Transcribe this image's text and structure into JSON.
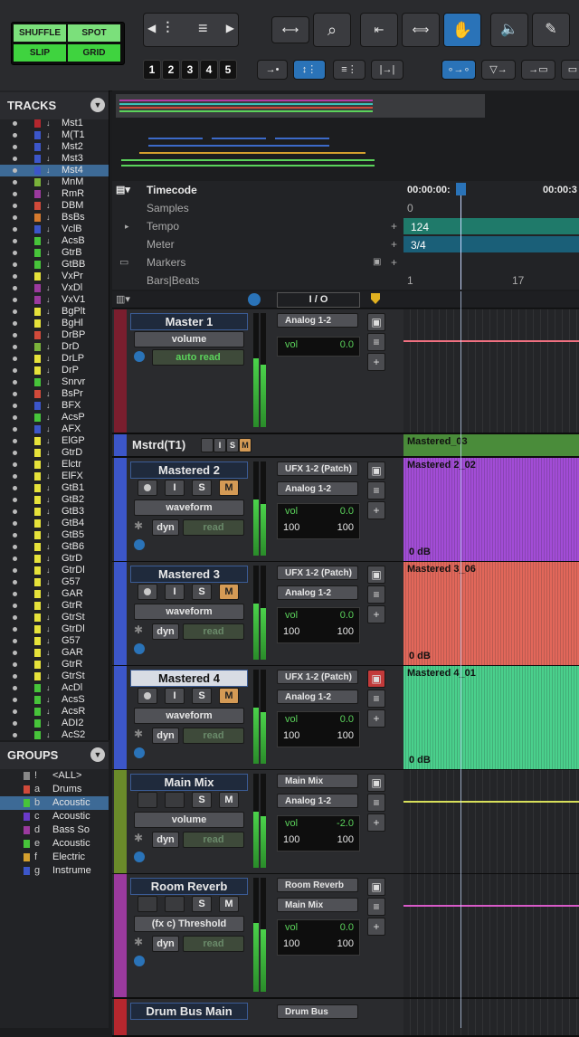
{
  "toolbar": {
    "modes": {
      "shuffle": "SHUFFLE",
      "spot": "SPOT",
      "slip": "SLIP",
      "grid": "GRID"
    },
    "zoom_presets": [
      "1",
      "2",
      "3",
      "4",
      "5"
    ],
    "icons": [
      "trim-icon",
      "zoom-icon",
      "selector-icon",
      "grabber-icon",
      "smart-tool-icon",
      "speaker-icon",
      "pencil-icon"
    ]
  },
  "tracks_panel": {
    "title": "TRACKS",
    "items": [
      {
        "name": "Mst1",
        "color": "#b5272e"
      },
      {
        "name": "M(T1",
        "color": "#3c56c9"
      },
      {
        "name": "Mst2",
        "color": "#3c56c9"
      },
      {
        "name": "Mst3",
        "color": "#3c56c9"
      },
      {
        "name": "Mst4",
        "color": "#3c56c9",
        "selected": true
      },
      {
        "name": "MnM",
        "color": "#7ab23a"
      },
      {
        "name": "RmR",
        "color": "#9b3a9e"
      },
      {
        "name": "DBM",
        "color": "#d14a3a"
      },
      {
        "name": "BsBs",
        "color": "#d57a2e"
      },
      {
        "name": "VclB",
        "color": "#3c56c9"
      },
      {
        "name": "AcsB",
        "color": "#47c43a"
      },
      {
        "name": "GtrB",
        "color": "#47c43a"
      },
      {
        "name": "GtBB",
        "color": "#47c43a"
      },
      {
        "name": "VxPr",
        "color": "#e6e23a"
      },
      {
        "name": "VxDl",
        "color": "#9b3a9e"
      },
      {
        "name": "VxV1",
        "color": "#9b3a9e"
      },
      {
        "name": "BgPlt",
        "color": "#e6e23a"
      },
      {
        "name": "BgHl",
        "color": "#e6e23a"
      },
      {
        "name": "DrBP",
        "color": "#d14a3a"
      },
      {
        "name": "DrD",
        "color": "#7ab23a"
      },
      {
        "name": "DrLP",
        "color": "#e6e23a"
      },
      {
        "name": "DrP",
        "color": "#e6e23a"
      },
      {
        "name": "Snrvr",
        "color": "#47c43a"
      },
      {
        "name": "BsPr",
        "color": "#d14a3a"
      },
      {
        "name": "BFX",
        "color": "#3c56c9"
      },
      {
        "name": "AcsP",
        "color": "#47c43a"
      },
      {
        "name": "AFX",
        "color": "#3c56c9"
      },
      {
        "name": "ElGP",
        "color": "#e6e23a"
      },
      {
        "name": "GtrD",
        "color": "#e6e23a"
      },
      {
        "name": "Elctr",
        "color": "#e6e23a"
      },
      {
        "name": "ElFX",
        "color": "#e6e23a"
      },
      {
        "name": "GtB1",
        "color": "#e6e23a"
      },
      {
        "name": "GtB2",
        "color": "#e6e23a"
      },
      {
        "name": "GtB3",
        "color": "#e6e23a"
      },
      {
        "name": "GtB4",
        "color": "#e6e23a"
      },
      {
        "name": "GtB5",
        "color": "#e6e23a"
      },
      {
        "name": "GtB6",
        "color": "#e6e23a"
      },
      {
        "name": "GtrD",
        "color": "#e6e23a"
      },
      {
        "name": "GtrDl",
        "color": "#e6e23a"
      },
      {
        "name": "G57",
        "color": "#e6e23a"
      },
      {
        "name": "GAR",
        "color": "#e6e23a"
      },
      {
        "name": "GtrR",
        "color": "#e6e23a"
      },
      {
        "name": "GtrSt",
        "color": "#e6e23a"
      },
      {
        "name": "GtrDl",
        "color": "#e6e23a"
      },
      {
        "name": "G57",
        "color": "#e6e23a"
      },
      {
        "name": "GAR",
        "color": "#e6e23a"
      },
      {
        "name": "GtrR",
        "color": "#e6e23a"
      },
      {
        "name": "GtrSt",
        "color": "#e6e23a"
      },
      {
        "name": "AcDl",
        "color": "#47c43a"
      },
      {
        "name": "AcsS",
        "color": "#47c43a"
      },
      {
        "name": "AcsR",
        "color": "#47c43a"
      },
      {
        "name": "ADI2",
        "color": "#47c43a"
      },
      {
        "name": "AcS2",
        "color": "#47c43a"
      }
    ]
  },
  "groups_panel": {
    "title": "GROUPS",
    "items": [
      {
        "letter": "!",
        "name": "<ALL>",
        "color": "#888888"
      },
      {
        "letter": "a",
        "name": "Drums",
        "color": "#d14a3a"
      },
      {
        "letter": "b",
        "name": "Acoustic",
        "color": "#47c43a",
        "selected": true
      },
      {
        "letter": "c",
        "name": "Acoustic",
        "color": "#6a3acb"
      },
      {
        "letter": "d",
        "name": "Bass So",
        "color": "#9b3a9e"
      },
      {
        "letter": "e",
        "name": "Acoustic",
        "color": "#47c43a"
      },
      {
        "letter": "f",
        "name": "Electric",
        "color": "#d5a02e"
      },
      {
        "letter": "g",
        "name": "Instrume",
        "color": "#3c56c9"
      }
    ]
  },
  "overview": {
    "lines": [
      {
        "color": "#b33aa8"
      },
      {
        "color": "#3ac4b9"
      },
      {
        "color": "#d14a3a"
      },
      {
        "color": "#5bd35b"
      }
    ]
  },
  "rulers": {
    "timecode_label": "Timecode",
    "samples_label": "Samples",
    "tempo_label": "Tempo",
    "meter_label": "Meter",
    "markers_label": "Markers",
    "bars_label": "Bars|Beats",
    "timecode_start": "00:00:00:",
    "timecode_next": "00:00:3",
    "samples_start": "0",
    "tempo_value": "124",
    "meter_value": "3/4",
    "bar_1": "1",
    "bar_17": "17"
  },
  "column_header": {
    "io": "I / O"
  },
  "tracks": [
    {
      "name": "Master 1",
      "color": "#7a1e2e",
      "send1": "volume",
      "send2": "auto read",
      "out": "Analog 1-2",
      "vol_label": "vol",
      "vol": "0.0",
      "clip_color": "#f07080",
      "type": "master"
    },
    {
      "name": "Mstrd(T1)",
      "color": "#3c56c9",
      "type": "compact",
      "clip_name": "Mastered_03",
      "clip_color": "#4a8c3a"
    },
    {
      "name": "Mastered 2",
      "color": "#3c56c9",
      "view": "waveform",
      "dyn": "dyn",
      "read": "read",
      "in": "UFX 1-2 (Patch)",
      "out": "Analog 1-2",
      "vol_label": "vol",
      "vol": "0.0",
      "pan_l": "100",
      "pan_r": "100",
      "clip_name": "Mastered 2_02",
      "clip_color": "#a24cd6",
      "db": "0 dB"
    },
    {
      "name": "Mastered 3",
      "color": "#3c56c9",
      "view": "waveform",
      "dyn": "dyn",
      "read": "read",
      "in": "UFX 1-2 (Patch)",
      "out": "Analog 1-2",
      "vol_label": "vol",
      "vol": "0.0",
      "pan_l": "100",
      "pan_r": "100",
      "clip_name": "Mastered 3_06",
      "clip_color": "#e2675a",
      "db": "0 dB"
    },
    {
      "name": "Mastered 4",
      "color": "#3c56c9",
      "view": "waveform",
      "dyn": "dyn",
      "read": "read",
      "in": "UFX 1-2 (Patch)",
      "out": "Analog 1-2",
      "vol_label": "vol",
      "vol": "0.0",
      "pan_l": "100",
      "pan_r": "100",
      "clip_name": "Mastered 4_01",
      "clip_color": "#4ad08c",
      "db": "0 dB",
      "selected": true
    },
    {
      "name": "Main Mix",
      "color": "#6a8a2a",
      "view": "volume",
      "dyn": "dyn",
      "read": "read",
      "in": "Main Mix",
      "out": "Analog 1-2",
      "vol_label": "vol",
      "vol": "-2.0",
      "pan_l": "100",
      "pan_r": "100",
      "clip_color": "#d8e05a"
    },
    {
      "name": "Room Reverb",
      "color": "#9b3a9e",
      "view": "(fx c) Threshold",
      "dyn": "dyn",
      "read": "read",
      "in": "Room Reverb",
      "out": "Main Mix",
      "vol_label": "vol",
      "vol": "0.0",
      "pan_l": "100",
      "pan_r": "100",
      "clip_color": "#d85ac8"
    },
    {
      "name": "Drum Bus Main",
      "color": "#b5272e",
      "in": "Drum Bus",
      "type": "partial"
    }
  ]
}
